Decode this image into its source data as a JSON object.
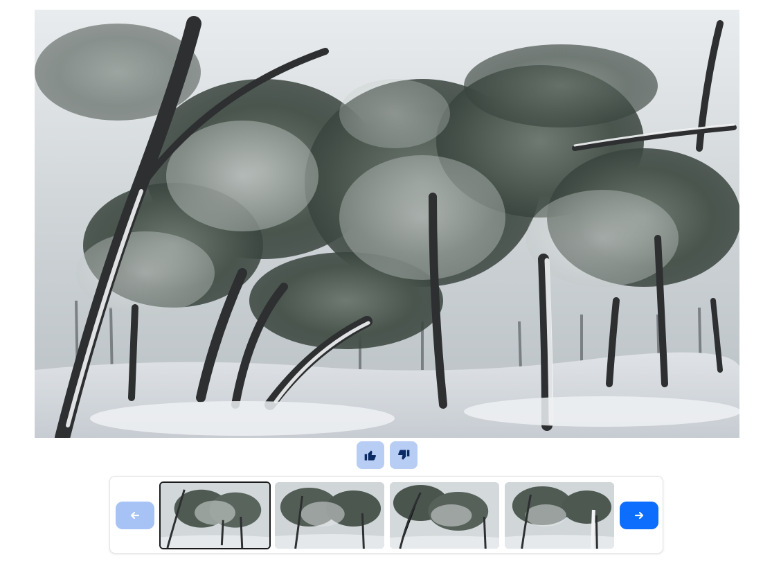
{
  "main_image": {
    "icon": "snowy-pine-forest-photo",
    "alt_text": ""
  },
  "reactions": {
    "like_icon": "thumbs-up-icon",
    "dislike_icon": "thumbs-down-icon",
    "button_color": "#b7cdf3",
    "icon_color": "#0a2a63"
  },
  "carousel": {
    "prev_icon": "arrow-left-icon",
    "next_icon": "arrow-right-icon",
    "prev_state": "disabled",
    "next_state": "enabled",
    "accent_color": "#0d6efd",
    "selected_index": 0,
    "thumbnails": [
      {
        "icon": "snowy-forest-thumbnail-1"
      },
      {
        "icon": "snowy-forest-thumbnail-2"
      },
      {
        "icon": "snowy-forest-thumbnail-3"
      },
      {
        "icon": "snowy-forest-thumbnail-4"
      }
    ]
  }
}
